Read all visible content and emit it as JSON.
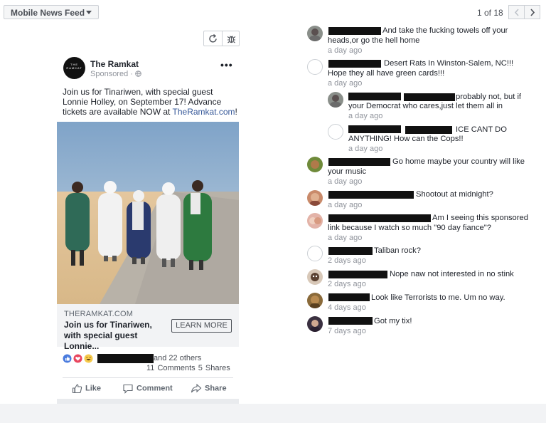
{
  "toolbar": {
    "feed_label": "Mobile News Feed",
    "pager": "1 of 18"
  },
  "post": {
    "page_name": "The Ramkat",
    "logo_text": "THE RAMKAT",
    "sponsored": "Sponsored · ",
    "text_main": "Join us for Tinariwen, with special guest Lonnie Holley, on September 17! Advance tickets are available NOW at ",
    "text_link": "TheRamkat.com",
    "text_end": "!",
    "domain": "THERAMKAT.COM",
    "headline": "Join us for Tinariwen, with special guest Lonnie...",
    "cta": "LEARN MORE",
    "reactions_others": "and 22 others",
    "comments_count": "11 Comments",
    "shares_count": "5 Shares",
    "actions": {
      "like": "Like",
      "comment": "Comment",
      "share": "Share"
    }
  },
  "comments": [
    {
      "text1": "And take the fucking towels off your",
      "text2": "heads,or go the hell home",
      "time": "a day ago"
    },
    {
      "text1": "Desert Rats In Winston-Salem, NC!!!",
      "text2": "Hope they all have green cards!!!",
      "time": "a day ago"
    },
    {
      "text1": "probably not, but if",
      "text2": "your Democrat who cares,just let them all in",
      "time": "a day ago"
    },
    {
      "text1": "ICE CANT DO",
      "text2": "ANYTHING! How can the Cops!!",
      "time": "a day ago"
    },
    {
      "text1": "Go home maybe your country will like",
      "text2": "your music",
      "time": "a day ago"
    },
    {
      "text1": "Shootout at midnight?",
      "time": "a day ago"
    },
    {
      "text1": "Am I seeing this sponsored",
      "text2": "link because I watch so much \"90 day fiance\"?",
      "time": "a day ago"
    },
    {
      "text1": "Taliban rock?",
      "time": "2 days ago"
    },
    {
      "text1": "Nope naw not interested in no stink",
      "time": "2 days ago"
    },
    {
      "text1": "Look like Terrorists to me. Um no way.",
      "time": "4 days ago"
    },
    {
      "text1": "Got my tix!",
      "time": "7 days ago"
    }
  ],
  "colors": {
    "link": "#365899",
    "meta": "#90949c",
    "redaction": "#111111"
  },
  "icons": [
    "chevron-down-icon",
    "chevron-left-icon",
    "chevron-right-icon",
    "refresh-icon",
    "bug-icon",
    "globe-icon",
    "more-icon",
    "like-reaction-icon",
    "love-reaction-icon",
    "haha-reaction-icon",
    "thumbs-up-icon",
    "comment-icon",
    "share-icon"
  ]
}
